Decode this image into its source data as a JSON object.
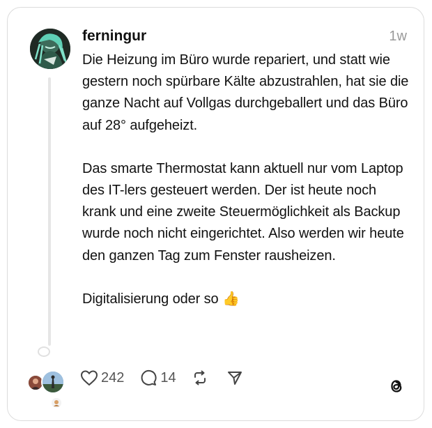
{
  "post": {
    "username": "ferningur",
    "time": "1w",
    "paragraphs": [
      "Die Heizung im Büro wurde repariert, und statt wie gestern noch spürbare Kälte abzustrahlen, hat sie die ganze Nacht auf Vollgas durchgeballert und das Büro auf 28° aufgeheizt.",
      "Das smarte Thermostat kann aktuell nur vom Laptop des IT-lers gesteuert werden. Der ist heute noch krank und eine zweite Steuermöglichkeit als Backup wurde noch nicht eingerichtet. Also werden wir heute den ganzen Tag zum Fenster rausheizen.",
      "Digitalisierung oder so 👍"
    ]
  },
  "actions": {
    "likes": "242",
    "replies": "14",
    "like_icon": "heart-icon",
    "reply_icon": "comment-icon",
    "repost_icon": "repost-icon",
    "share_icon": "send-icon"
  },
  "colors": {
    "text": "#111111",
    "muted": "#999999",
    "border": "#dcdcdc",
    "thread_line": "#e6e6e6"
  },
  "branding": {
    "logo_icon": "threads-logo-icon"
  }
}
